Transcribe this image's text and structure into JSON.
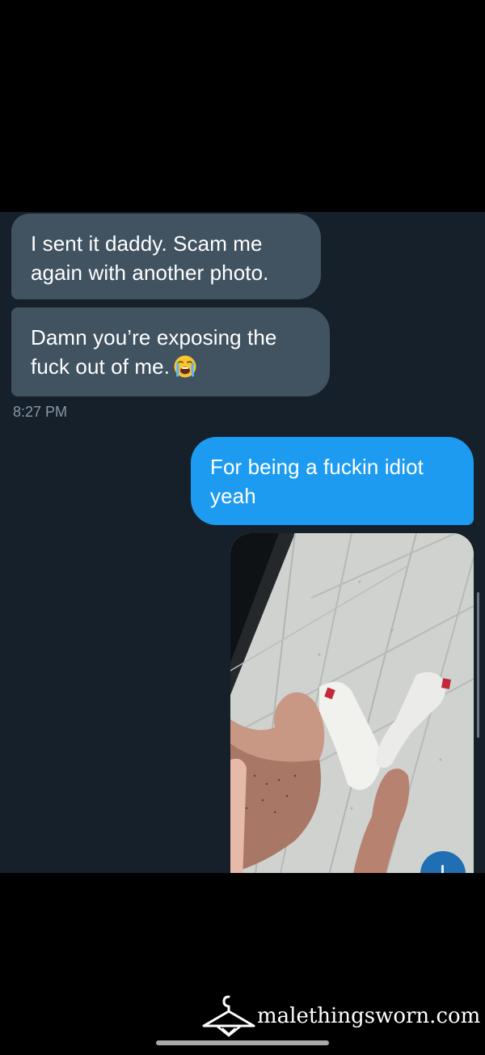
{
  "conversation": {
    "messages": [
      {
        "direction": "incoming",
        "text": "I sent it daddy. Scam me again with another photo."
      },
      {
        "direction": "incoming",
        "text": "Damn you’re exposing the fuck out of me.",
        "emoji": "loudly-crying-face"
      },
      {
        "direction": "outgoing",
        "text": "For being a fuckin idiot yeah"
      }
    ],
    "timestamp": "8:27 PM",
    "attachment": {
      "type": "photo",
      "subject": "white socks on tiled floor with bare feet"
    }
  },
  "watermark": {
    "text": "malethingsworn.com",
    "icon": "hanger-icon"
  },
  "colors": {
    "chat_background": "#16202b",
    "incoming_bubble": "#415261",
    "outgoing_bubble": "#1d9bf0",
    "timestamp": "#8b98a5",
    "frame": "#000000"
  }
}
